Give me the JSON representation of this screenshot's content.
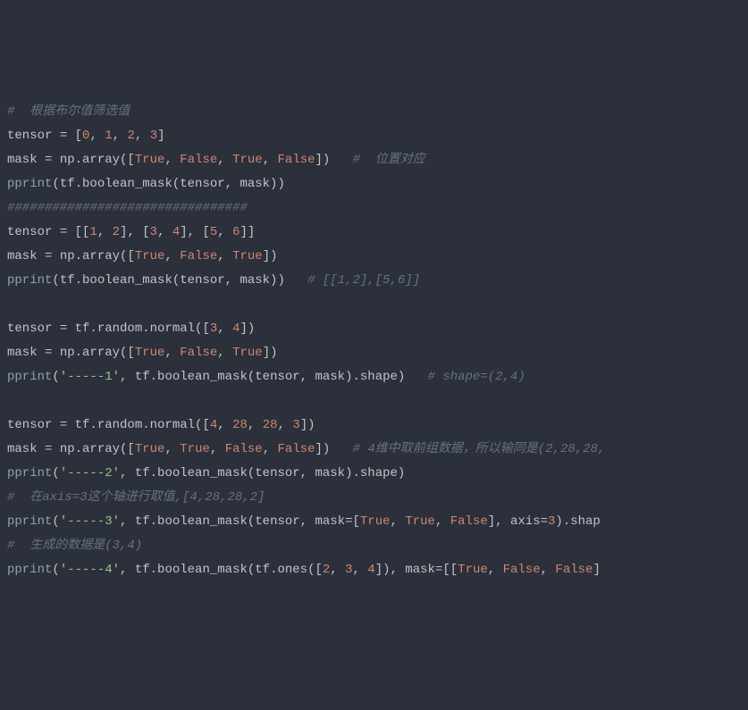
{
  "code": {
    "l1": {
      "comment": "#  根据布尔值筛选值"
    },
    "l2": {
      "a": "tensor ",
      "b": "= [",
      "n0": "0",
      "c": ", ",
      "n1": "1",
      "d": ", ",
      "n2": "2",
      "e": ", ",
      "n3": "3",
      "f": "]"
    },
    "l3": {
      "a": "mask ",
      "b": "= np.array([",
      "t0": "True",
      "c": ", ",
      "t1": "False",
      "d": ", ",
      "t2": "True",
      "e": ", ",
      "t3": "False",
      "f": "])   ",
      "comment": "#  位置对应"
    },
    "l4": {
      "fn": "pprint",
      "a": "(tf.boolean_mask(tensor, mask))"
    },
    "l5": {
      "comment": "################################"
    },
    "l6": {
      "a": "tensor ",
      "b": "= [[",
      "n0": "1",
      "c": ", ",
      "n1": "2",
      "d": "], [",
      "n2": "3",
      "e": ", ",
      "n3": "4",
      "f": "], [",
      "n4": "5",
      "g": ", ",
      "n5": "6",
      "h": "]]"
    },
    "l7": {
      "a": "mask ",
      "b": "= np.array([",
      "t0": "True",
      "c": ", ",
      "t1": "False",
      "d": ", ",
      "t2": "True",
      "e": "])"
    },
    "l8": {
      "fn": "pprint",
      "a": "(tf.boolean_mask(tensor, mask))   ",
      "comment": "# [[1,2],[5,6]]"
    },
    "l9": {
      "blank": ""
    },
    "l10": {
      "a": "tensor ",
      "b": "= tf.random.normal([",
      "n0": "3",
      "c": ", ",
      "n1": "4",
      "d": "])"
    },
    "l11": {
      "a": "mask ",
      "b": "= np.array([",
      "t0": "True",
      "c": ", ",
      "t1": "False",
      "d": ", ",
      "t2": "True",
      "e": "])"
    },
    "l12": {
      "fn": "pprint",
      "a": "(",
      "s": "'-----1'",
      "b": ", tf.boolean_mask(tensor, mask).shape)   ",
      "comment": "# shape=(2,4)"
    },
    "l13": {
      "blank": ""
    },
    "l14": {
      "a": "tensor ",
      "b": "= tf.random.normal([",
      "n0": "4",
      "c": ", ",
      "n1": "28",
      "d": ", ",
      "n2": "28",
      "e": ", ",
      "n3": "3",
      "f": "])"
    },
    "l15": {
      "a": "mask ",
      "b": "= np.array([",
      "t0": "True",
      "c": ", ",
      "t1": "True",
      "d": ", ",
      "t2": "False",
      "e": ", ",
      "t3": "False",
      "f": "])   ",
      "comment": "# 4维中取前组数据，所以输同是(2,28,28,"
    },
    "l16": {
      "fn": "pprint",
      "a": "(",
      "s": "'-----2'",
      "b": ", tf.boolean_mask(tensor, mask).shape)"
    },
    "l17": {
      "comment": "#  在axis=3这个轴进行取值,[4,28,28,2]"
    },
    "l18": {
      "fn": "pprint",
      "a": "(",
      "s": "'-----3'",
      "b": ", tf.boolean_mask(tensor, ",
      "kw": "mask",
      "c": "=[",
      "t0": "True",
      "d": ", ",
      "t1": "True",
      "e": ", ",
      "t2": "False",
      "f": "], ",
      "kw2": "axis",
      "g": "=",
      "n0": "3",
      "h": ").shap"
    },
    "l19": {
      "comment": "#  生成的数据是(3,4)"
    },
    "l20": {
      "fn": "pprint",
      "a": "(",
      "s": "'-----4'",
      "b": ", tf.boolean_mask(tf.ones([",
      "n0": "2",
      "c": ", ",
      "n1": "3",
      "d": ", ",
      "n2": "4",
      "e": "]), ",
      "kw": "mask",
      "f": "=[[",
      "t0": "True",
      "g": ", ",
      "t1": "False",
      "h": ", ",
      "t2": "False",
      "i": "]"
    }
  }
}
